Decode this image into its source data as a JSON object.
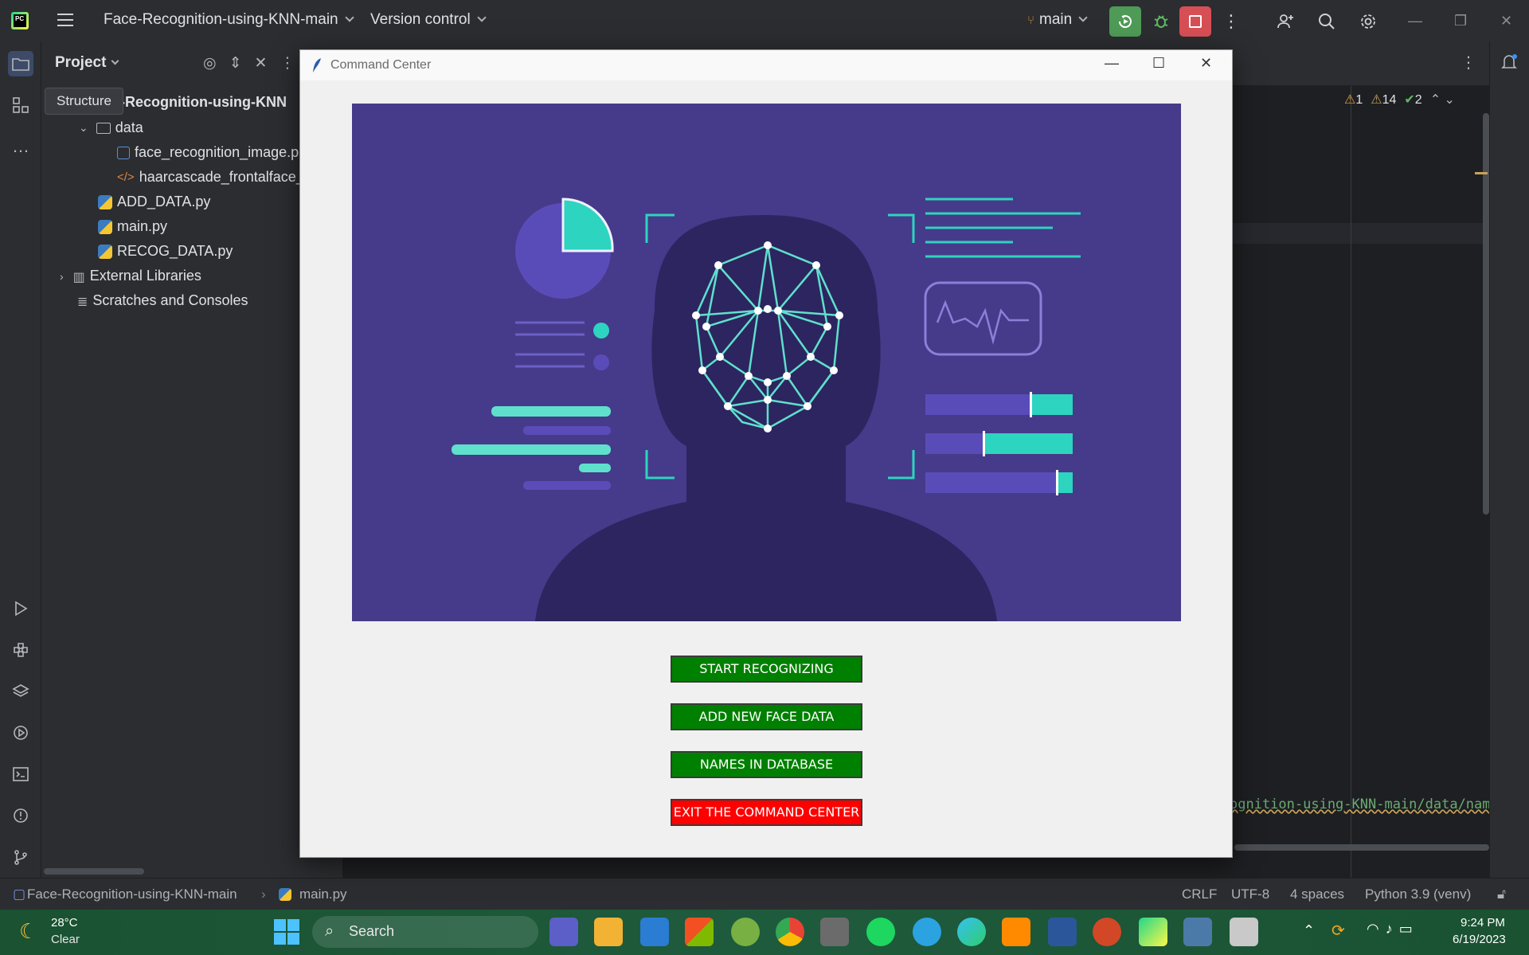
{
  "titlebar": {
    "project_name": "Face-Recognition-using-KNN-main",
    "vcs_label": "Version control",
    "branch": "main"
  },
  "project_panel": {
    "title": "Project",
    "tooltip": "Structure",
    "root": "e-Recognition-using-KNN",
    "items": [
      {
        "label": "data",
        "type": "folder"
      },
      {
        "label": "face_recognition_image.p",
        "type": "image"
      },
      {
        "label": "haarcascade_frontalface_",
        "type": "xml"
      },
      {
        "label": "ADD_DATA.py",
        "type": "python"
      },
      {
        "label": "main.py",
        "type": "python"
      },
      {
        "label": "RECOG_DATA.py",
        "type": "python"
      },
      {
        "label": "External Libraries",
        "type": "library"
      },
      {
        "label": "Scratches and Consoles",
        "type": "scratch"
      }
    ]
  },
  "editor": {
    "inspections": {
      "errors": "1",
      "warnings": "14",
      "ok": "2"
    },
    "path_fragment": "ognition-using-KNN-main/data/nam"
  },
  "dialog": {
    "title": "Command Center",
    "buttons": {
      "start": "START RECOGNIZING",
      "add": "ADD NEW FACE DATA",
      "names": "NAMES IN DATABASE",
      "exit": "EXIT THE COMMAND CENTER"
    },
    "colors": {
      "green": "#008000",
      "red": "#ff0000",
      "hero_bg": "#463a8a",
      "accent": "#2dd4bf"
    }
  },
  "statusbar": {
    "breadcrumb_project": "Face-Recognition-using-KNN-main",
    "breadcrumb_file": "main.py",
    "line_ending": "CRLF",
    "encoding": "UTF-8",
    "indent": "4 spaces",
    "interpreter": "Python 3.9 (venv)"
  },
  "taskbar": {
    "weather_temp": "28°C",
    "weather_desc": "Clear",
    "search_label": "Search",
    "time": "9:24 PM",
    "date": "6/19/2023"
  }
}
